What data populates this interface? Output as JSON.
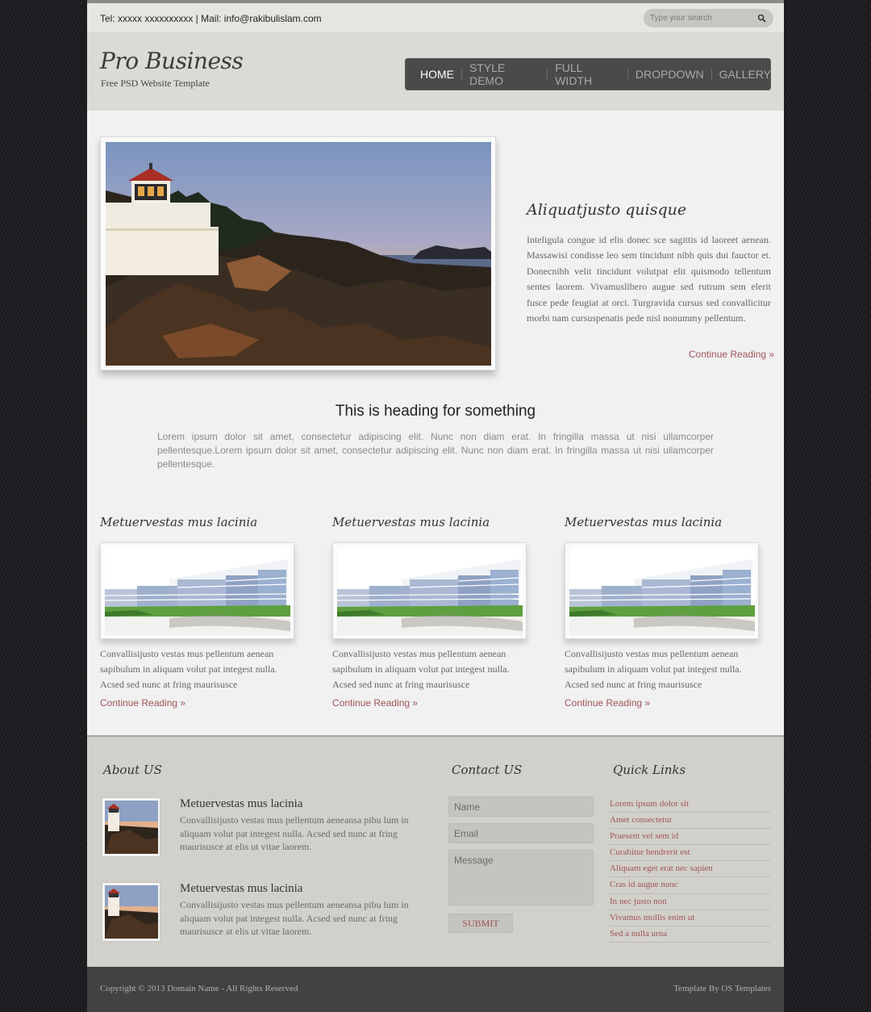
{
  "topbar": {
    "contact": "Tel: xxxxx xxxxxxxxxx | Mail: info@rakibulislam.com",
    "search_placeholder": "Type your search",
    "search_icon": "search-icon"
  },
  "header": {
    "logo": "Pro Business",
    "tagline": "Free PSD Website Template"
  },
  "nav": {
    "items": [
      "HOME",
      "STYLE DEMO",
      "FULL WIDTH",
      "DROPDOWN",
      "GALLERY"
    ],
    "active": "HOME"
  },
  "feature": {
    "title": "Aliquatjusto quisque",
    "text": "Inteligula congue id elis donec sce sagittis id laoreet aenean. Massawisi condisse leo sem tincidunt nibh quis dui fauctor et. Donecnibh velit tincidunt volutpat elit quismodo tellentum sentes laorem. Vivamuslibero augue sed rutrum sem elerit fusce pede feugiat at orci. Turgravida cursus sed convallicitur morbi nam cursuspenatis pede nisl nonummy pellentum.",
    "more": "Continue Reading »"
  },
  "intro": {
    "heading": "This is heading for something",
    "text": "Lorem ipsum dolor sit amet, consectetur adipiscing elit. Nunc non diam erat. In fringilla massa ut nisi ullamcorper pellentesque.Lorem ipsum dolor sit amet, consectetur adipiscing elit. Nunc non diam erat. In fringilla massa ut nisi ullamcorper pellentesque."
  },
  "columns": [
    {
      "title": "Metuervestas mus lacinia",
      "text": "Convallisijusto vestas mus pellentum aenean sapibulum in aliquam volut pat integest nulla. Acsed sed nunc at fring maurisusce",
      "more": "Continue Reading »"
    },
    {
      "title": "Metuervestas mus lacinia",
      "text": "Convallisijusto vestas mus pellentum aenean sapibulum in aliquam volut pat integest nulla. Acsed sed nunc at fring maurisusce",
      "more": "Continue Reading »"
    },
    {
      "title": "Metuervestas mus lacinia",
      "text": "Convallisijusto vestas mus pellentum aenean sapibulum in aliquam volut pat integest nulla. Acsed sed nunc at fring maurisusce",
      "more": "Continue Reading »"
    }
  ],
  "about": {
    "title": "About US",
    "items": [
      {
        "title": "Metuervestas mus lacinia",
        "text": "Convallisijusto vestas mus pellentum aeneansa pibu lum in aliquam volut pat integest nulla. Acsed sed nunc at fring maurisusce at elis ut vitae laorem."
      },
      {
        "title": "Metuervestas mus lacinia",
        "text": "Convallisijusto vestas mus pellentum aeneansa pibu lum in aliquam volut pat integest nulla. Acsed sed nunc at fring maurisusce at elis ut vitae laorem."
      }
    ]
  },
  "contact": {
    "title": "Contact US",
    "name_placeholder": "Name",
    "email_placeholder": "Email",
    "message_placeholder": "Message",
    "submit": "SUBMIT"
  },
  "quicklinks": {
    "title": "Quick Links",
    "links": [
      "Lorem ipsum dolor sit",
      "Amet consectetur",
      "Praesent vel sem id",
      "Curabitur hendrerit est",
      "Aliquam eget erat nec sapien",
      "Cras id augue nunc",
      "In nec justo non",
      "Vivamus mollis enim ut",
      "Sed a nulla urna"
    ]
  },
  "footer": {
    "copyright": "Copyright © 2013 Domain Name - All Rights Reserved",
    "credit": "Template By OS Templates"
  }
}
